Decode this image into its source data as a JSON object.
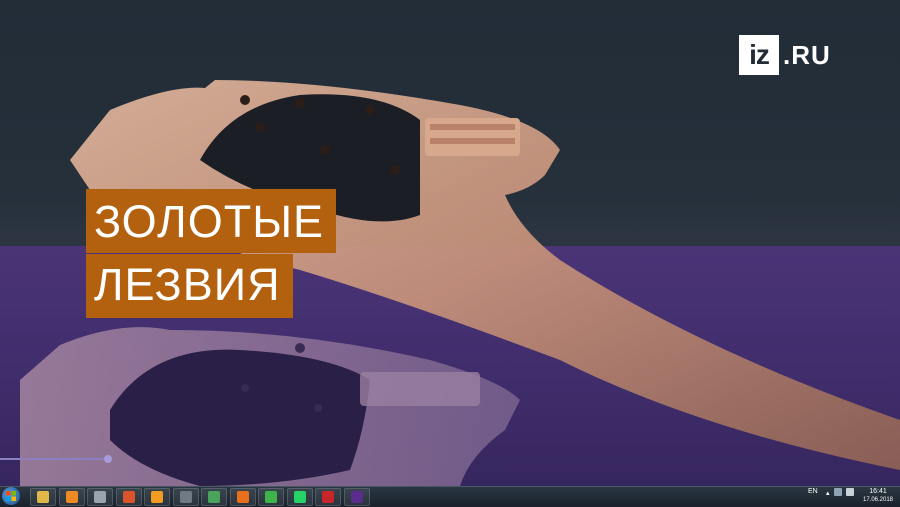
{
  "video": {
    "title_line1": "ЗОЛОТЫЕ",
    "title_line2": "ЛЕЗВИЯ",
    "logo_box": "iz",
    "logo_domain": ".RU",
    "accent_color": "#b3600f",
    "band_color": "#4a3477",
    "progress_fraction": 0.12
  },
  "taskbar": {
    "apps": [
      {
        "name": "windows-explorer-icon",
        "color": "#e0b84a"
      },
      {
        "name": "media-player-icon",
        "color": "#f08a24"
      },
      {
        "name": "tool-icon",
        "color": "#9aa4b0"
      },
      {
        "name": "slides-icon",
        "color": "#d9532b"
      },
      {
        "name": "vlc-icon",
        "color": "#f39c1f"
      },
      {
        "name": "video-editor-icon",
        "color": "#6f7a85"
      },
      {
        "name": "paint-icon",
        "color": "#4aa35a"
      },
      {
        "name": "firefox-icon",
        "color": "#e8701a"
      },
      {
        "name": "clover-icon",
        "color": "#3fb44a"
      },
      {
        "name": "whatsapp-icon",
        "color": "#25d366"
      },
      {
        "name": "filezilla-icon",
        "color": "#c7262a"
      },
      {
        "name": "premiere-icon",
        "color": "#5a2d8c"
      }
    ],
    "language": "EN",
    "time": "16:41",
    "date": "17.06.2018"
  }
}
